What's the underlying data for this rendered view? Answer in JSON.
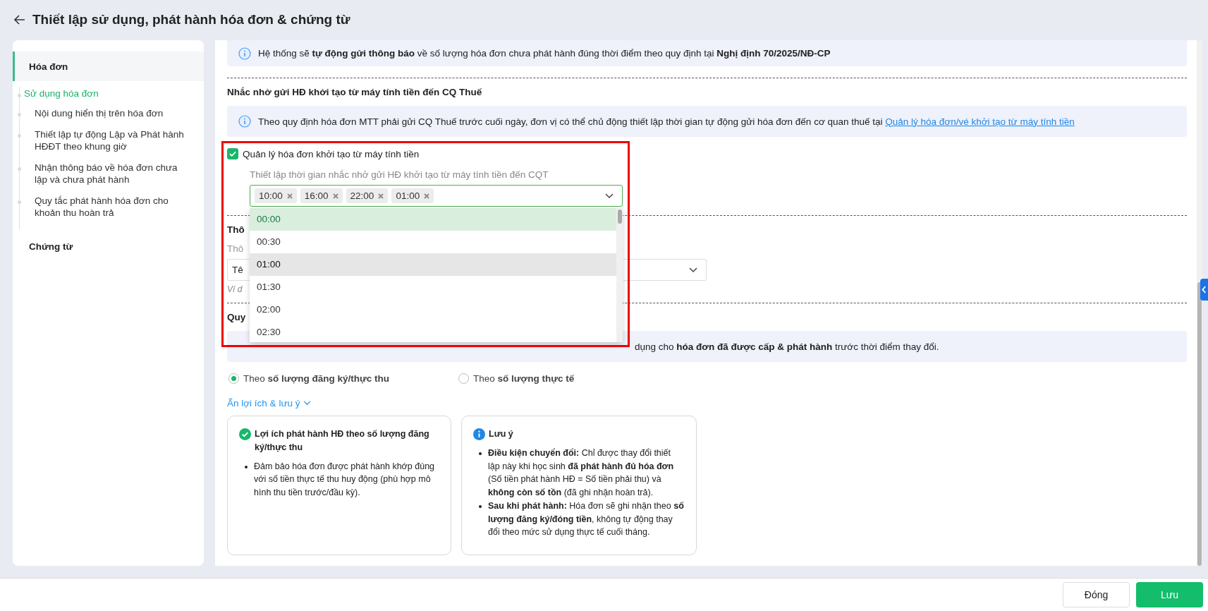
{
  "header": {
    "title": "Thiết lập sử dụng, phát hành hóa đơn & chứng từ"
  },
  "sidebar": {
    "sections": [
      {
        "label": "Hóa đơn",
        "selected": true,
        "children": [
          {
            "label": "Sử dụng hóa đơn",
            "selected": true,
            "children": [
              {
                "label": "Nội dung hiển thị trên hóa đơn",
                "selected": false
              },
              {
                "label": "Thiết lập tự động Lập và Phát hành HĐĐT theo khung giờ",
                "selected": false
              },
              {
                "label": "Nhận thông báo về hóa đơn chưa lập và chưa phát hành",
                "selected": false
              },
              {
                "label": "Quy tắc phát hành hóa đơn cho khoản thu hoàn trả",
                "selected": false
              }
            ]
          }
        ]
      },
      {
        "label": "Chứng từ",
        "selected": false
      }
    ]
  },
  "notice_top": {
    "text": "Hệ thống sẽ **tự động gửi thông báo** về số lượng hóa đơn chưa phát hành đúng thời điểm theo quy định tại **Nghị định 70/2025/NĐ-CP**"
  },
  "mtt_section": {
    "heading": "Nhắc nhở gửi HĐ khởi tạo từ máy tính tiền đến CQ Thuế",
    "notice": {
      "text": "Theo quy định hóa đơn MTT phải gửi CQ Thuế trước cuối ngày, đơn vị có thể chủ động thiết lập thời gian tự động gửi hóa đơn đến cơ quan thuế tại",
      "link": "Quản lý hóa đơn/vé khởi tạo từ máy tính tiền"
    },
    "checkbox": {
      "label": "Quản lý hóa đơn khởi tạo từ máy tính tiền",
      "checked": true
    },
    "time_select": {
      "label": "Thiết lập thời gian nhắc nhở gửi HĐ khởi tạo từ máy tính tiền đến CQT",
      "tags": [
        "10:00",
        "16:00",
        "22:00",
        "01:00"
      ],
      "expanded": true,
      "options": [
        {
          "label": "00:00",
          "selected": true,
          "highlighted": false
        },
        {
          "label": "00:30",
          "selected": false,
          "highlighted": false
        },
        {
          "label": "01:00",
          "selected": false,
          "highlighted": true
        },
        {
          "label": "01:30",
          "selected": false,
          "highlighted": false
        },
        {
          "label": "02:00",
          "selected": false,
          "highlighted": false
        },
        {
          "label": "02:30",
          "selected": false,
          "highlighted": false
        }
      ]
    }
  },
  "covered_section": {
    "heading": "Thô",
    "label": "Thô",
    "select_value": "Tê",
    "hint": "Ví d"
  },
  "rule_section": {
    "heading": "Quy",
    "notice": "dụng cho **hóa đơn đã được cấp & phát hành** trước thời điểm thay đổi.",
    "options": [
      {
        "label": "Theo **số lượng đăng ký/thực thu**",
        "selected": true
      },
      {
        "label": "Theo **số lượng thực tế**",
        "selected": false
      }
    ],
    "toggle_link": "Ẩn lợi ích & lưu ý",
    "cards": [
      {
        "kind": "benefit",
        "title": "Lợi ích phát hành HĐ theo số lượng đăng ký/thực thu",
        "bullets": [
          "Đảm bảo hóa đơn được phát hành khớp đúng với số tiền thực tế thu huy động (phù hợp mô hình thu tiền trước/đầu kỳ)."
        ]
      },
      {
        "kind": "note",
        "title": "Lưu ý",
        "bullets": [
          "**Điều kiện chuyển đổi:** Chỉ được thay đổi thiết lập này khi học sinh **đã phát hành đủ hóa đơn** (Số tiền phát hành HĐ = Số tiền phải thu) và **không còn số tồn** (đã ghi nhận hoàn trả).",
          "**Sau khi phát hành:** Hóa đơn sẽ ghi nhận theo **số lượng đăng ký/đóng tiền**, không tự động thay đổi theo mức sử dụng thực tế cuối tháng."
        ]
      }
    ]
  },
  "footer": {
    "buttons": [
      {
        "label": "Đóng",
        "kind": "secondary"
      },
      {
        "label": "Lưu",
        "kind": "primary"
      }
    ]
  }
}
